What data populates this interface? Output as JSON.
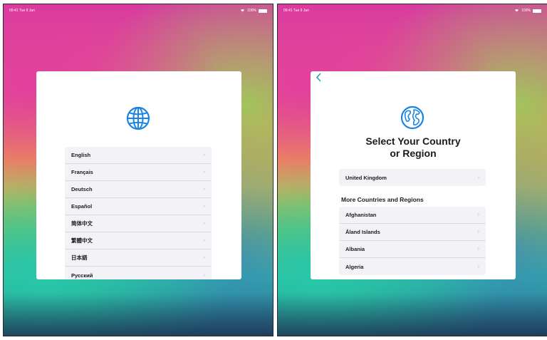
{
  "left_screen": {
    "status": {
      "time": "09:41 Tue 9 Jan",
      "battery": "100%"
    },
    "languages": [
      "English",
      "Français",
      "Deutsch",
      "Español",
      "简体中文",
      "繁體中文",
      "日本語",
      "Русский"
    ]
  },
  "right_screen": {
    "status": {
      "time": "09:41 Tue 9 Jan",
      "battery": "100%"
    },
    "back_icon": "chevron-left-icon",
    "title_line1": "Select Your Country",
    "title_line2": "or Region",
    "current_country": "United Kingdom",
    "section_title": "More Countries and Regions",
    "countries": [
      "Afghanistan",
      "Åland Islands",
      "Albania",
      "Algeria"
    ]
  },
  "colors": {
    "accent": "#2aa1b3",
    "list_bg": "#f2f2f7"
  }
}
